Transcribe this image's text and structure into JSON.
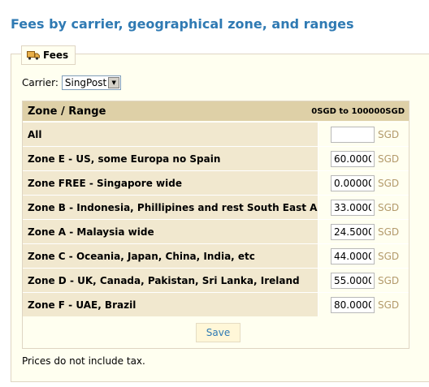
{
  "page": {
    "title": "Fees by carrier, geographical zone, and ranges"
  },
  "fieldset": {
    "legend": "Fees",
    "legend_icon": "delivery-truck-icon"
  },
  "carrier": {
    "label": "Carrier:",
    "selected": "SingPost"
  },
  "table": {
    "header_zone": "Zone / Range",
    "header_range": "0SGD to 100000SGD",
    "currency": "SGD",
    "rows": [
      {
        "zone": "All",
        "fee": ""
      },
      {
        "zone": "Zone E - US, some Europa no Spain",
        "fee": "60.0000"
      },
      {
        "zone": "Zone FREE - Singapore wide",
        "fee": "0.00000"
      },
      {
        "zone": "Zone B - Indonesia, Phillipines and rest South East Asia",
        "fee": "33.0000"
      },
      {
        "zone": "Zone A - Malaysia wide",
        "fee": "24.5000"
      },
      {
        "zone": "Zone C - Oceania, Japan, China, India, etc",
        "fee": "44.0000"
      },
      {
        "zone": "Zone D - UK, Canada, Pakistan, Sri Lanka, Ireland",
        "fee": "55.0000"
      },
      {
        "zone": "Zone F - UAE, Brazil",
        "fee": "80.0000"
      }
    ],
    "save_label": "Save"
  },
  "note": "Prices do not include tax.",
  "colors": {
    "title": "#2f7ab3",
    "header_bg": "#ded0a7",
    "zone_bg": "#f1e8cf",
    "panel_bg": "#fffff0",
    "currency_text": "#b39a6b"
  }
}
